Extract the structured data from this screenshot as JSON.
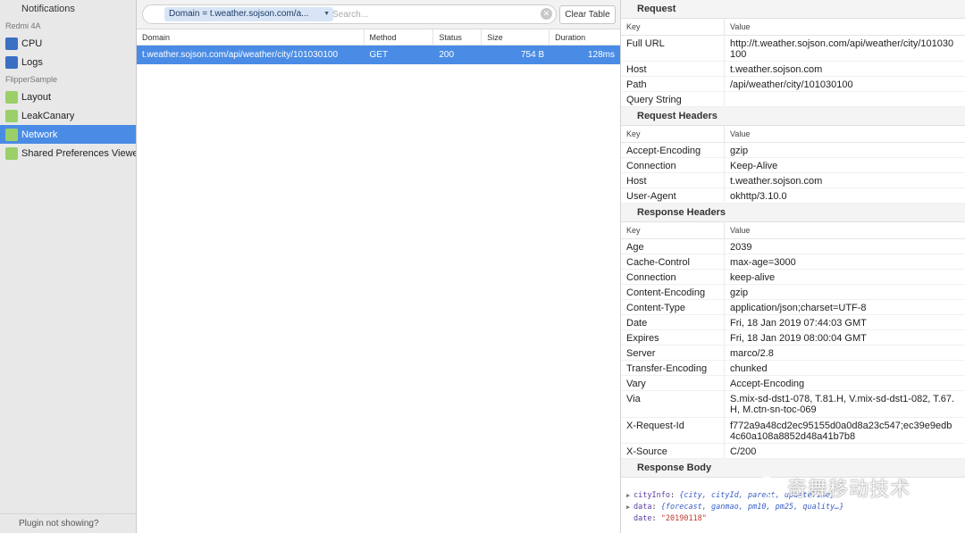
{
  "sidebar": {
    "header": "Notifications",
    "groups": [
      {
        "label": "Redmi 4A"
      },
      {
        "label": "FlipperSample"
      }
    ],
    "items": [
      {
        "label": "CPU",
        "color": "#3b6fc4"
      },
      {
        "label": "Logs",
        "color": "#3b6fc4"
      },
      {
        "label": "Layout",
        "color": "#9bcf6a"
      },
      {
        "label": "LeakCanary",
        "color": "#9bcf6a"
      },
      {
        "label": "Network",
        "color": "#9bcf6a",
        "active": true
      },
      {
        "label": "Shared Preferences Viewer",
        "color": "#9bcf6a"
      }
    ],
    "footer": "Plugin not showing?"
  },
  "toolbar": {
    "filter_token": "Domain = t.weather.sojson.com/a...",
    "search_placeholder": "Search...",
    "clear_table_label": "Clear Table"
  },
  "table": {
    "columns": [
      "Domain",
      "Method",
      "Status",
      "Size",
      "Duration"
    ],
    "rows": [
      {
        "domain": "t.weather.sojson.com/api/weather/city/101030100",
        "method": "GET",
        "status": "200",
        "size": "754 B",
        "duration": "128ms"
      }
    ]
  },
  "detail": {
    "key_header": "Key",
    "value_header": "Value",
    "request": {
      "title": "Request",
      "rows": [
        {
          "k": "Full URL",
          "v": "http://t.weather.sojson.com/api/weather/city/101030100"
        },
        {
          "k": "Host",
          "v": "t.weather.sojson.com"
        },
        {
          "k": "Path",
          "v": "/api/weather/city/101030100"
        },
        {
          "k": "Query String",
          "v": ""
        }
      ]
    },
    "request_headers": {
      "title": "Request Headers",
      "rows": [
        {
          "k": "Accept-Encoding",
          "v": "gzip"
        },
        {
          "k": "Connection",
          "v": "Keep-Alive"
        },
        {
          "k": "Host",
          "v": "t.weather.sojson.com"
        },
        {
          "k": "User-Agent",
          "v": "okhttp/3.10.0"
        }
      ]
    },
    "response_headers": {
      "title": "Response Headers",
      "rows": [
        {
          "k": "Age",
          "v": "2039"
        },
        {
          "k": "Cache-Control",
          "v": "max-age=3000"
        },
        {
          "k": "Connection",
          "v": "keep-alive"
        },
        {
          "k": "Content-Encoding",
          "v": "gzip"
        },
        {
          "k": "Content-Type",
          "v": "application/json;charset=UTF-8"
        },
        {
          "k": "Date",
          "v": "Fri, 18 Jan 2019 07:44:03 GMT"
        },
        {
          "k": "Expires",
          "v": "Fri, 18 Jan 2019 08:00:04 GMT"
        },
        {
          "k": "Server",
          "v": "marco/2.8"
        },
        {
          "k": "Transfer-Encoding",
          "v": "chunked"
        },
        {
          "k": "Vary",
          "v": "Accept-Encoding"
        },
        {
          "k": "Via",
          "v": "S.mix-sd-dst1-078, T.81.H, V.mix-sd-dst1-082, T.67.H, M.ctn-sn-toc-069"
        },
        {
          "k": "X-Request-Id",
          "v": "f772a9a48cd2ec95155d0a0d8a23c547;ec39e9edb4c60a108a8852d48a41b7b8"
        },
        {
          "k": "X-Source",
          "v": "C/200"
        }
      ]
    },
    "response_body": {
      "title": "Response Body",
      "lines": [
        {
          "key": "cityInfo",
          "summary": "{city, cityId, parent, updateTime}"
        },
        {
          "key": "data",
          "summary": "{forecast, ganmao, pm10, pm25, quality…}"
        },
        {
          "key": "date",
          "string": "\"20190118\""
        }
      ]
    }
  },
  "watermark": "奇舞移动技术"
}
